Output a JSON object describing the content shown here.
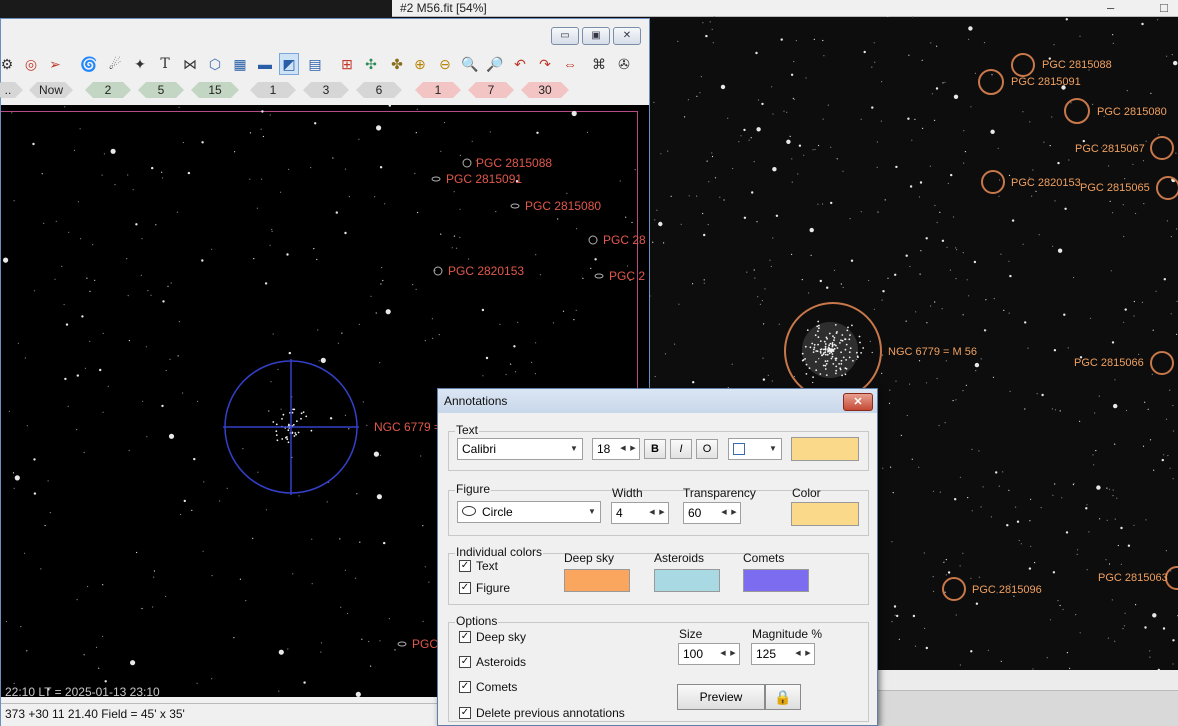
{
  "fit_window": {
    "title": "#2 M56.fit  [54%]",
    "minimize": "–",
    "restore": "□",
    "labels": [
      "PGC 2815088",
      "PGC 2815091",
      "PGC 2815080",
      "PGC 2815067",
      "PGC 2820153",
      "PGC 2815065",
      "NGC 6779 = M 56",
      "PGC 2815066",
      "PGC 2815096",
      "PGC 2815063"
    ]
  },
  "carte": {
    "window_buttons": {
      "minimize": "▭",
      "restore": "▣",
      "close": "✕"
    },
    "toolbar_icons": [
      "gear-icon",
      "target-icon",
      "arrow-icon",
      "galaxy-icon",
      "comet-icon",
      "asteroid-icon",
      "text-icon",
      "constellation-icon",
      "outline-icon",
      "grid-icon",
      "horizon-icon",
      "milkyway-icon",
      "layers-icon",
      "add-object-icon",
      "star-cluster-icon",
      "planets-icon",
      "plus-icon",
      "minus-icon",
      "zoom-in-icon",
      "zoom-out-icon",
      "undo-icon",
      "redo-icon",
      "flip-icon",
      "network-icon",
      "eyepiece-icon"
    ],
    "steps": [
      {
        "label": "..",
        "style": "gray"
      },
      {
        "label": "Now",
        "style": "gray"
      },
      {
        "label": "2",
        "style": "green"
      },
      {
        "label": "5",
        "style": "green"
      },
      {
        "label": "15",
        "style": "green"
      },
      {
        "label": "1",
        "style": "gray"
      },
      {
        "label": "3",
        "style": "gray"
      },
      {
        "label": "6",
        "style": "gray"
      },
      {
        "label": "1",
        "style": "pink"
      },
      {
        "label": "7",
        "style": "pink"
      },
      {
        "label": "30",
        "style": "pink"
      }
    ],
    "sky_labels": [
      "PGC 2815088",
      "PGC 2815091",
      "PGC 2815080",
      "PGC 28",
      "PGC 2820153",
      "PGC 2",
      "NGC 6779 =",
      "PGC"
    ],
    "sky_time": "22:10      LT = 2025-01-13  23:10",
    "status": "373 +30 11 21.40  Field  =  45' x 35'"
  },
  "dialog": {
    "title": "Annotations",
    "close": "✕",
    "text_group": {
      "label": "Text",
      "font": "Calibri",
      "size": "18",
      "bold": "B",
      "italic": "I",
      "outline": "O",
      "color": "#fbd98a"
    },
    "figure_group": {
      "label": "Figure",
      "shape": "Circle",
      "width_label": "Width",
      "width": "4",
      "transparency_label": "Transparency",
      "transparency": "60",
      "color_label": "Color",
      "color": "#fbd98a"
    },
    "individual_group": {
      "label": "Individual colors",
      "text_check": "Text",
      "figure_check": "Figure",
      "deep_sky_label": "Deep sky",
      "deep_sky_color": "#fba65e",
      "asteroids_label": "Asteroids",
      "asteroids_color": "#a9d9e3",
      "comets_label": "Comets",
      "comets_color": "#7b6cf0"
    },
    "options_group": {
      "label": "Options",
      "deep_sky": "Deep sky",
      "asteroids": "Asteroids",
      "comets": "Comets",
      "delete_prev": "Delete previous annotations",
      "size_label": "Size",
      "size": "100",
      "magnitude_label": "Magnitude %",
      "magnitude": "125",
      "preview": "Preview"
    }
  }
}
